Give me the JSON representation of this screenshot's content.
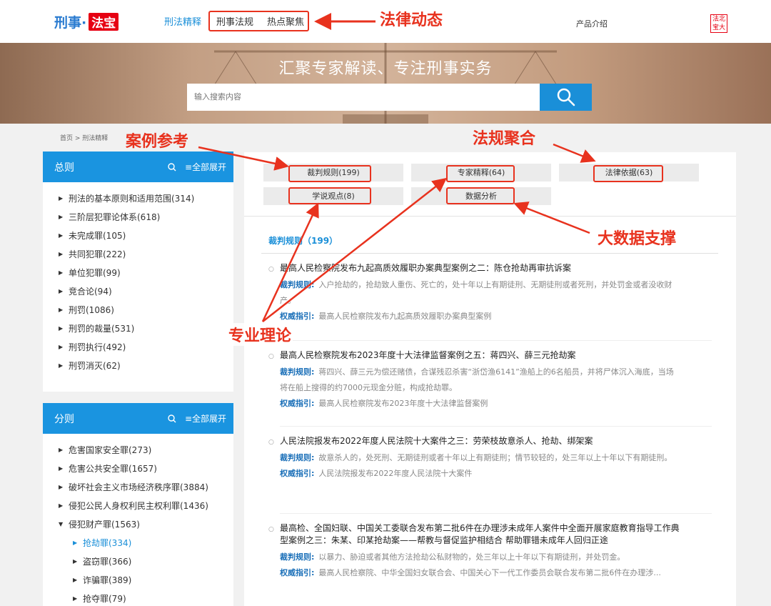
{
  "header": {
    "logo_part1": "刑事·",
    "logo_part2": "法宝",
    "nav": [
      "刑法精释",
      "刑事法规",
      "热点聚焦"
    ],
    "product_link": "产品介绍",
    "brand_seal": "法北宝大"
  },
  "banner": {
    "title": "汇聚专家解读、专注刑事实务",
    "search_placeholder": "输入搜索内容"
  },
  "breadcrumb": "首页 > 刑法精释",
  "sidebar": {
    "general": {
      "title": "总则",
      "expand_label": "≡全部展开",
      "items": [
        "刑法的基本原则和适用范围(314)",
        "三阶层犯罪论体系(618)",
        "未完成罪(105)",
        "共同犯罪(222)",
        "单位犯罪(99)",
        "竞合论(94)",
        "刑罚(1086)",
        "刑罚的裁量(531)",
        "刑罚执行(492)",
        "刑罚消灭(62)"
      ]
    },
    "specific": {
      "title": "分则",
      "expand_label": "≡全部展开",
      "items": [
        "危害国家安全罪(273)",
        "危害公共安全罪(1657)",
        "破坏社会主义市场经济秩序罪(3884)",
        "侵犯公民人身权利民主权利罪(1436)",
        "侵犯财产罪(1563)"
      ],
      "sub_items": [
        "抢劫罪(334)",
        "盗窃罪(366)",
        "诈骗罪(389)",
        "抢夺罪(79)"
      ]
    }
  },
  "tabs": [
    "裁判规则(199)",
    "专家精释(64)",
    "法律依据(63)",
    "学说观点(8)",
    "数据分析"
  ],
  "section_title": "裁判规则（199）",
  "labels": {
    "rule": "裁判规则:",
    "guide": "权威指引:"
  },
  "cases": [
    {
      "title": "最高人民检察院发布九起高质效履职办案典型案例之二：陈仓抢劫再审抗诉案",
      "rule": "入户抢劫的，抢劫致人重伤、死亡的，处十年以上有期徒刑、无期徒刑或者死刑，并处罚金或者没收财产。",
      "guide": "最高人民检察院发布九起高质效履职办案典型案例"
    },
    {
      "title": "最高人民检察院发布2023年度十大法律监督案例之五：蒋四兴、薛三元抢劫案",
      "rule": "蒋四兴、薛三元为偿还赌债，合谋残忍杀害“浙岱渔6141”渔船上的6名船员，并将尸体沉入海底，当场将在船上搜得的约7000元现金分赃，构成抢劫罪。",
      "guide": "最高人民检察院发布2023年度十大法律监督案例"
    },
    {
      "title": "人民法院报发布2022年度人民法院十大案件之三：劳荣枝故意杀人、抢劫、绑架案",
      "rule": "故意杀人的，处死刑、无期徒刑或者十年以上有期徒刑；情节较轻的，处三年以上十年以下有期徒刑。",
      "guide": "人民法院报发布2022年度人民法院十大案件"
    },
    {
      "title": "最高检、全国妇联、中国关工委联合发布第二批6件在办理涉未成年人案件中全面开展家庭教育指导工作典型案例之三：朱某、印某抢劫案——帮教与督促监护相结合 帮助罪错未成年人回归正途",
      "rule": "以暴力、胁迫或者其他方法抢劫公私财物的，处三年以上十年以下有期徒刑，并处罚金。",
      "guide": "最高人民检察院、中华全国妇女联合会、中国关心下一代工作委员会联合发布第二批6件在办理涉..."
    }
  ],
  "annotations": [
    "法律动态",
    "案例参考",
    "法规聚合",
    "大数据支撑",
    "专业理论"
  ],
  "colors": {
    "accent": "#1a94e0",
    "annotation": "#e8321e",
    "brand_red": "#e60012"
  }
}
